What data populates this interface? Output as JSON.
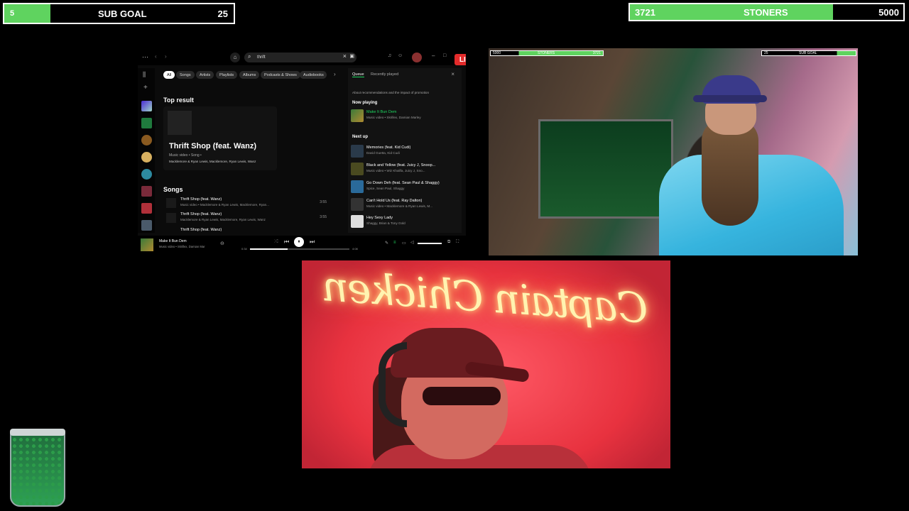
{
  "sub_goal": {
    "current": "5",
    "label": "SUB GOAL",
    "target": "25",
    "progress": 0.2,
    "color": "#5fd35f"
  },
  "stoners_goal": {
    "current": "3721",
    "label": "STONERS",
    "target": "5000",
    "progress": 0.744,
    "color": "#5fd35f"
  },
  "spotify": {
    "search_value": "thrift",
    "live_badge": "LIVE",
    "filters": [
      "All",
      "Songs",
      "Artists",
      "Playlists",
      "Albums",
      "Podcasts & Shows",
      "Audiobooks"
    ],
    "top_result_heading": "Top result",
    "top_result": {
      "title": "Thrift Shop (feat. Wanz)",
      "meta": "Music video • Song •",
      "artists": "Macklemore & Ryan Lewis, Macklemore, Ryan Lewis, Wanz"
    },
    "songs_heading": "Songs",
    "songs": [
      {
        "title": "Thrift Shop (feat. Wanz)",
        "artists": "Music video • Macklemore & Ryan Lewis, Macklemore, Ryan...",
        "duration": "3:55"
      },
      {
        "title": "Thrift Shop (feat. Wanz)",
        "artists": "Macklemore & Ryan Lewis, Macklemore, Ryan Lewis, Wanz",
        "duration": "3:55"
      },
      {
        "title": "Thrift Shop (feat. Wanz)",
        "artists": "",
        "duration": ""
      }
    ],
    "queue_tabs": [
      "Queue",
      "Recently played"
    ],
    "queue_note": "About recommendations and the impact of promotion",
    "now_playing_heading": "Now playing",
    "now_playing": {
      "title": "Make It Bun Dem",
      "sub": "Music video • Skrillex, Damian Marley"
    },
    "next_up_heading": "Next up",
    "next_up": [
      {
        "title": "Memories (feat. Kid Cudi)",
        "sub": "David Guetta, Kid Cudi"
      },
      {
        "title": "Black and Yellow (feat. Juicy J, Snoop...",
        "sub": "Music video • Wiz Khalifa, Juicy J, Sno..."
      },
      {
        "title": "Go Down Deh (feat. Sean Paul & Shaggy)",
        "sub": "Spice, Sean Paul, Shaggy"
      },
      {
        "title": "Can't Hold Us (feat. Ray Dalton)",
        "sub": "Music video • Macklemore & Ryan Lewis, M..."
      },
      {
        "title": "Hey Sexy Lady",
        "sub": "Shaggy, Brian & Tony Gold"
      }
    ],
    "player": {
      "track": "Make It Bun Dem",
      "artist": "Music video • Skrillex, Damian Mar",
      "elapsed": "0:34",
      "total": "4:08",
      "progress": 0.38
    }
  },
  "cam1_overlay": {
    "left": "5000",
    "mid": "STONERS",
    "right": "3721",
    "sub_left": "25",
    "sub_label": "SUB GOAL"
  },
  "cam2_neon": "Captain Chicken"
}
